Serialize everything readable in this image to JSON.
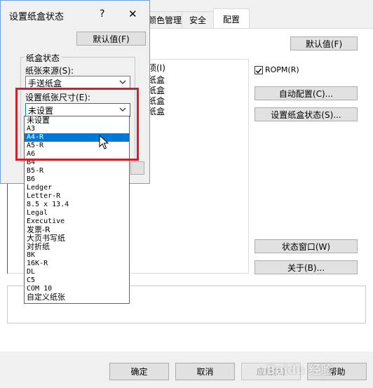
{
  "main": {
    "tabs": [
      {
        "label": "颜色管理"
      },
      {
        "label": "安全"
      },
      {
        "label": "配置"
      }
    ],
    "default_button": "默认值(F)",
    "list_header": "项(I)",
    "list_items": [
      "纸盒",
      "纸盒",
      "纸盒",
      "纸盒"
    ],
    "ropm_label": "ROPM(R)",
    "auto_config_button": "自动配置(C)...",
    "tray_status_button": "设置纸盒状态(S)...",
    "status_window_button": "状态窗口(W)",
    "about_button": "关于(B)...",
    "ok_button": "确定",
    "cancel_button": "取消",
    "apply_button": "应用(A)",
    "help_button": "帮助"
  },
  "dialog": {
    "title": "设置纸盒状态",
    "help_glyph": "?",
    "close_glyph": "✕",
    "default_button": "默认值(F)",
    "group_label": "纸盒状态",
    "source_label": "纸张来源(S):",
    "source_value": "手送纸盒",
    "size_label": "设置纸张尺寸(E):",
    "size_value": "未设置"
  },
  "dropdown": {
    "options": [
      "未设置",
      "A3",
      "A4-R",
      "A5-R",
      "A6",
      "B4",
      "B5-R",
      "B6",
      "Ledger",
      "Letter-R",
      "8.5 x 13.4",
      "Legal",
      "Executive",
      "发票-R",
      "大页书写纸",
      "对折纸",
      "8K",
      "16K-R",
      "DL",
      "C5",
      "COM 10",
      "自定义纸张"
    ],
    "selected_index": 2
  },
  "watermark": "Baidu 经验"
}
